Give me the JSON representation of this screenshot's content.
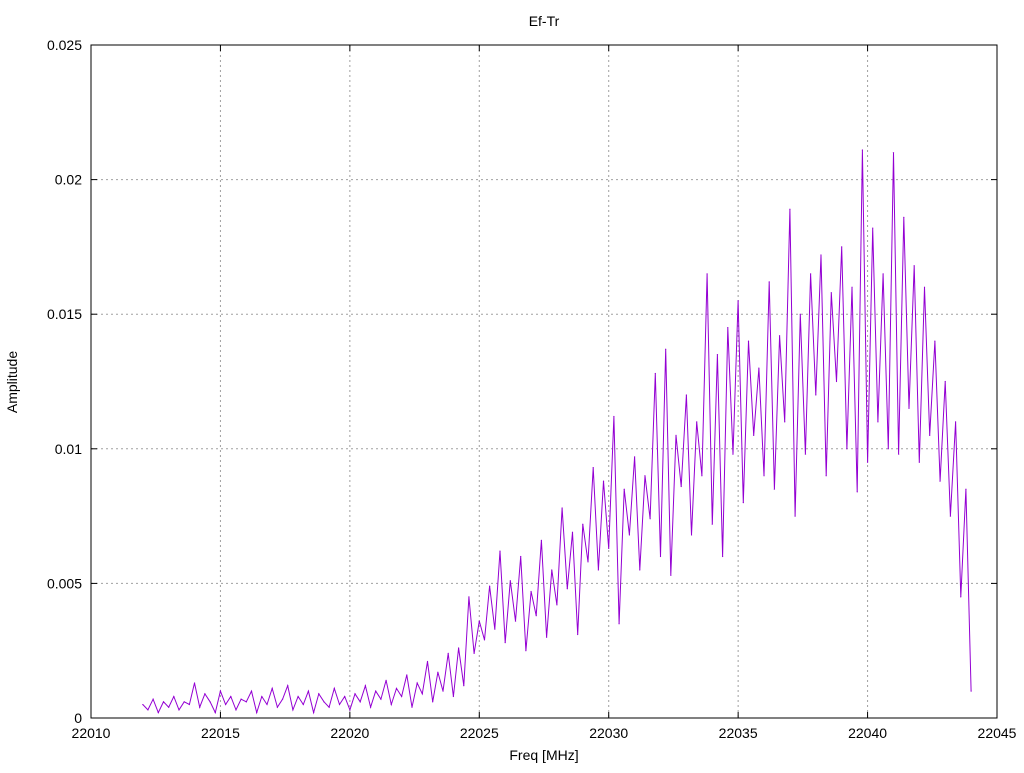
{
  "chart_data": {
    "type": "line",
    "title": "Ef-Tr",
    "xlabel": "Freq [MHz]",
    "ylabel": "Amplitude",
    "xlim": [
      22010,
      22045
    ],
    "ylim": [
      0,
      0.025
    ],
    "grid": true,
    "xticks": [
      "22010",
      "22015",
      "22020",
      "22025",
      "22030",
      "22035",
      "22040",
      "22045"
    ],
    "xtick_values": [
      22010,
      22015,
      22020,
      22025,
      22030,
      22035,
      22040,
      22045
    ],
    "yticks": [
      "0",
      "0.005",
      "0.01",
      "0.015",
      "0.02",
      "0.025"
    ],
    "ytick_values": [
      0,
      0.005,
      0.01,
      0.015,
      0.02,
      0.025
    ],
    "series": [
      {
        "name": "Ef-Tr",
        "color": "#9400d3",
        "x_start": 22012.0,
        "x_step": 0.2,
        "values": [
          0.0005,
          0.0003,
          0.0007,
          0.0002,
          0.0006,
          0.0004,
          0.0008,
          0.0003,
          0.0006,
          0.0005,
          0.0013,
          0.0004,
          0.0009,
          0.0006,
          0.0002,
          0.001,
          0.0005,
          0.0008,
          0.0003,
          0.0007,
          0.0006,
          0.001,
          0.0002,
          0.0008,
          0.0005,
          0.0011,
          0.0004,
          0.0007,
          0.0012,
          0.0003,
          0.0008,
          0.0005,
          0.001,
          0.0002,
          0.0009,
          0.0006,
          0.0004,
          0.0011,
          0.0005,
          0.0008,
          0.0003,
          0.0009,
          0.0006,
          0.0012,
          0.0004,
          0.001,
          0.0007,
          0.0014,
          0.0005,
          0.0011,
          0.0008,
          0.0016,
          0.0004,
          0.0013,
          0.0009,
          0.0021,
          0.0006,
          0.0017,
          0.001,
          0.0024,
          0.0008,
          0.0026,
          0.0012,
          0.0045,
          0.0024,
          0.0036,
          0.0029,
          0.0049,
          0.0033,
          0.0062,
          0.0028,
          0.0051,
          0.0036,
          0.006,
          0.0025,
          0.0047,
          0.0038,
          0.0066,
          0.003,
          0.0055,
          0.0042,
          0.0078,
          0.0048,
          0.0069,
          0.0031,
          0.0072,
          0.0058,
          0.0093,
          0.0055,
          0.0088,
          0.0063,
          0.0112,
          0.0035,
          0.0085,
          0.0068,
          0.0097,
          0.0055,
          0.009,
          0.0074,
          0.0128,
          0.006,
          0.0137,
          0.0053,
          0.0105,
          0.0086,
          0.012,
          0.0068,
          0.011,
          0.009,
          0.0165,
          0.0072,
          0.0135,
          0.006,
          0.0145,
          0.0098,
          0.0155,
          0.008,
          0.014,
          0.0105,
          0.013,
          0.009,
          0.0162,
          0.0085,
          0.0142,
          0.011,
          0.0189,
          0.0075,
          0.015,
          0.0098,
          0.0165,
          0.012,
          0.0172,
          0.009,
          0.0158,
          0.0125,
          0.0175,
          0.01,
          0.016,
          0.0084,
          0.0211,
          0.0095,
          0.0182,
          0.011,
          0.0165,
          0.01,
          0.021,
          0.0098,
          0.0186,
          0.0115,
          0.0168,
          0.0095,
          0.016,
          0.0105,
          0.014,
          0.0088,
          0.0125,
          0.0075,
          0.011,
          0.0045,
          0.0085,
          0.001
        ]
      }
    ]
  }
}
